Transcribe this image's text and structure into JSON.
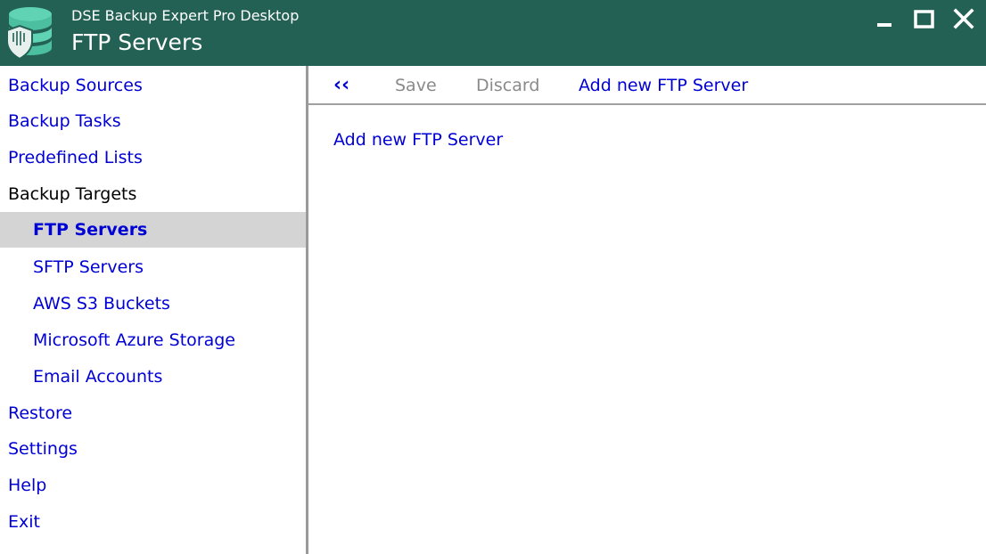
{
  "window": {
    "app_name": "DSE Backup Expert Pro Desktop",
    "page_title": "FTP Servers",
    "titlebar_color": "#236155",
    "icons": {
      "app": "database-shield-icon",
      "minimize": "minimize-icon",
      "maximize": "maximize-icon",
      "close": "close-icon"
    }
  },
  "sidebar": {
    "link_color": "#0000d4",
    "active_background": "#d4d4d4",
    "items": [
      {
        "label": "Backup Sources"
      },
      {
        "label": "Backup Tasks"
      },
      {
        "label": "Predefined Lists"
      },
      {
        "label": "Backup Targets"
      },
      {
        "label": "FTP Servers"
      },
      {
        "label": "SFTP Servers"
      },
      {
        "label": "AWS S3 Buckets"
      },
      {
        "label": "Microsoft Azure Storage"
      },
      {
        "label": "Email Accounts"
      },
      {
        "label": "Restore"
      },
      {
        "label": "Settings"
      },
      {
        "label": "Help"
      },
      {
        "label": "Exit"
      }
    ],
    "active_item": "FTP Servers"
  },
  "toolbar": {
    "back_label": "‹‹",
    "save_label": "Save",
    "discard_label": "Discard",
    "add_label": "Add new FTP Server"
  },
  "main": {
    "add_link_label": "Add new FTP Server"
  }
}
